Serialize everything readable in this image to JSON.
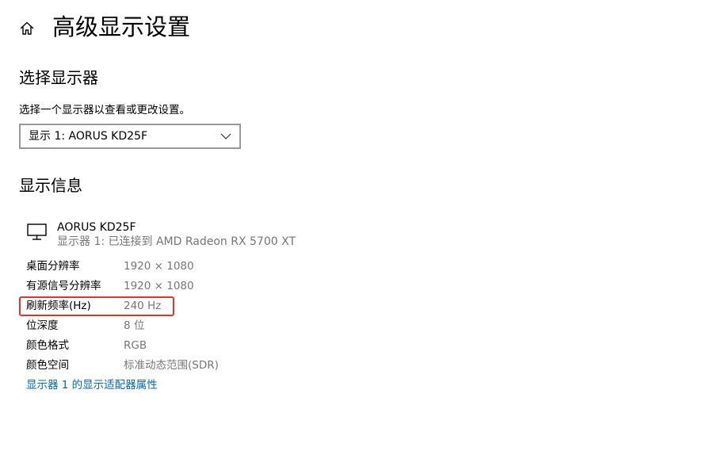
{
  "header": {
    "home_icon": "home-icon",
    "title": "高级显示设置"
  },
  "select_display": {
    "heading": "选择显示器",
    "hint": "选择一个显示器以查看或更改设置。",
    "selected_value": "显示 1: AORUS KD25F",
    "chevron_icon": "chevron-down-icon"
  },
  "display_info": {
    "heading": "显示信息",
    "monitor_icon": "monitor-icon",
    "monitor_name": "AORUS KD25F",
    "monitor_connection": "显示器 1: 已连接到 AMD Radeon RX 5700 XT",
    "rows": [
      {
        "label": "桌面分辨率",
        "value": "1920 × 1080"
      },
      {
        "label": "有源信号分辨率",
        "value": "1920 × 1080"
      },
      {
        "label": "刷新频率(Hz)",
        "value": "240 Hz"
      },
      {
        "label": "位深度",
        "value": "8 位"
      },
      {
        "label": "颜色格式",
        "value": "RGB"
      },
      {
        "label": "颜色空间",
        "value": "标准动态范围(SDR)"
      }
    ],
    "highlighted_row_index": 2,
    "adapter_link": "显示器 1 的显示适配器属性"
  },
  "colors": {
    "link": "#0067c0",
    "secondary_text": "#767676",
    "highlight_border": "#e5322d",
    "select_border": "#999999"
  }
}
